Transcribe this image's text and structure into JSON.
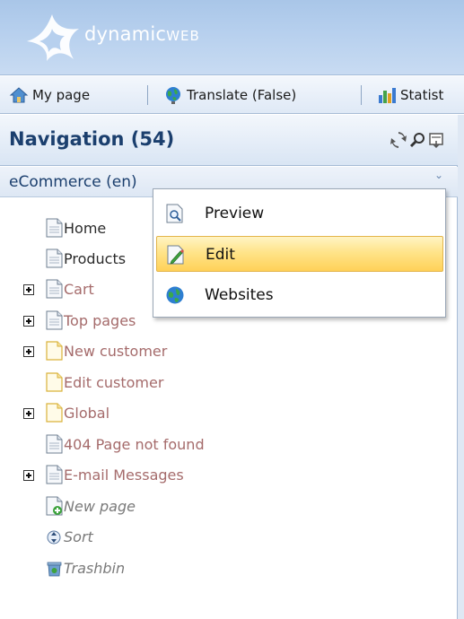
{
  "brand": {
    "name_lower": "dynamic",
    "name_caps": "WEB"
  },
  "toolbar": {
    "items": [
      {
        "label": "My page",
        "icon": "home-icon"
      },
      {
        "label": "Translate (False)",
        "icon": "globe-icon"
      },
      {
        "label": "Statist",
        "icon": "bar-chart-icon"
      }
    ]
  },
  "navigation": {
    "title": "Navigation (54)",
    "header_icons": [
      "refresh-icon",
      "search-icon",
      "filter-icon"
    ],
    "area": {
      "label": "eCommerce (",
      "hidden_suffix": "en)"
    },
    "tree": [
      {
        "label": "Home",
        "expandable": false,
        "icon": "page-icon",
        "style": "dark"
      },
      {
        "label": "Products",
        "expandable": false,
        "icon": "page-icon",
        "style": "dark"
      },
      {
        "label": "Cart",
        "expandable": true,
        "icon": "page-icon",
        "style": "mauve"
      },
      {
        "label": "Top pages",
        "expandable": true,
        "icon": "page-icon",
        "style": "mauve"
      },
      {
        "label": "New customer",
        "expandable": true,
        "icon": "folder-page-icon",
        "style": "mauve"
      },
      {
        "label": "Edit customer",
        "expandable": false,
        "icon": "folder-page-icon",
        "style": "mauve"
      },
      {
        "label": "Global",
        "expandable": true,
        "icon": "folder-page-icon",
        "style": "mauve"
      },
      {
        "label": "404 Page not found",
        "expandable": false,
        "icon": "page-icon",
        "style": "mauve"
      },
      {
        "label": "E-mail Messages",
        "expandable": true,
        "icon": "page-icon",
        "style": "mauve"
      },
      {
        "label": "New page",
        "expandable": false,
        "icon": "new-page-icon",
        "style": "italic"
      },
      {
        "label": "Sort",
        "expandable": false,
        "icon": "sort-icon",
        "style": "italic"
      },
      {
        "label": "Trashbin",
        "expandable": false,
        "icon": "trashbin-icon",
        "style": "italic"
      }
    ]
  },
  "context_menu": {
    "items": [
      {
        "label": "Preview",
        "icon": "preview-icon",
        "active": false
      },
      {
        "label": "Edit",
        "icon": "edit-icon",
        "active": true
      },
      {
        "label": "Websites",
        "icon": "globe-icon",
        "active": false
      }
    ]
  }
}
